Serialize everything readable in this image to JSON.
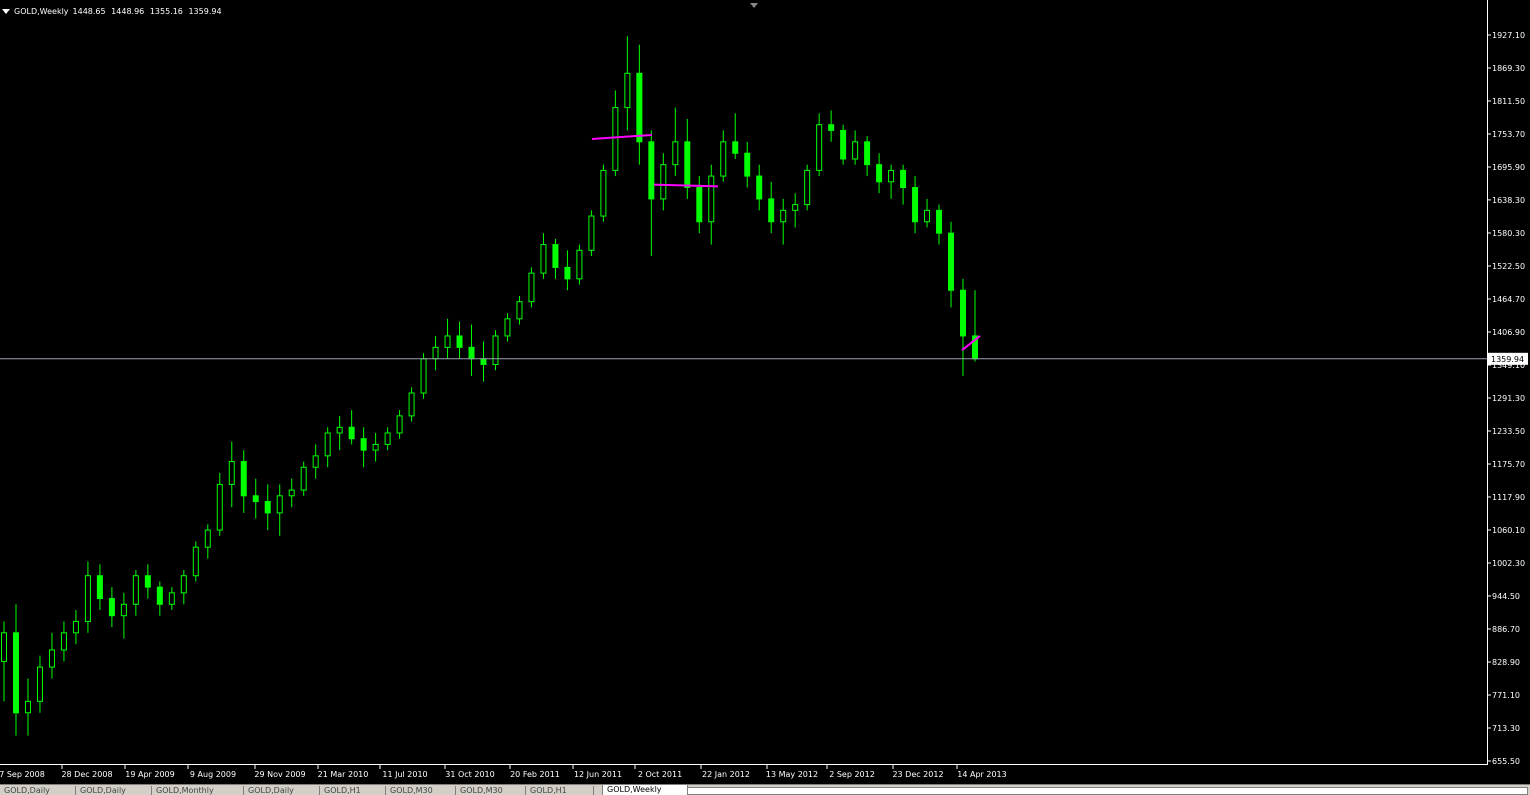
{
  "header": {
    "symbol_timeframe": "GOLD,Weekly",
    "open": "1448.65",
    "high": "1448.96",
    "low": "1355.16",
    "close": "1359.94"
  },
  "price_axis": {
    "labels": [
      "1927.10",
      "1869.30",
      "1811.50",
      "1753.70",
      "1695.90",
      "1638.30",
      "1580.30",
      "1522.50",
      "1464.70",
      "1406.90",
      "1349.10",
      "1291.30",
      "1233.50",
      "1175.70",
      "1117.90",
      "1060.10",
      "1002.30",
      "944.50",
      "886.70",
      "828.90",
      "771.10",
      "713.30",
      "655.50"
    ],
    "current_price": "1359.94"
  },
  "time_axis": {
    "labels": [
      "7 Sep 2008",
      "28 Dec 2008",
      "19 Apr 2009",
      "9 Aug 2009",
      "29 Nov 2009",
      "21 Mar 2010",
      "11 Jul 2010",
      "31 Oct 2010",
      "20 Feb 2011",
      "12 Jun 2011",
      "2 Oct 2011",
      "22 Jan 2012",
      "13 May 2012",
      "2 Sep 2012",
      "23 Dec 2012",
      "14 Apr 2013"
    ]
  },
  "tabs": [
    {
      "label": "GOLD,Daily",
      "active": false
    },
    {
      "label": "GOLD,Daily",
      "active": false
    },
    {
      "label": "GOLD,Monthly",
      "active": false
    },
    {
      "label": "GOLD,Daily",
      "active": false
    },
    {
      "label": "GOLD,H1",
      "active": false
    },
    {
      "label": "GOLD,M30",
      "active": false
    },
    {
      "label": "GOLD,M30",
      "active": false
    },
    {
      "label": "GOLD,H1",
      "active": false
    },
    {
      "label": "GOLD,Weekly",
      "active": true
    }
  ],
  "colors": {
    "background": "#000000",
    "candle": "#00ff00",
    "annotation": "#ff00ff",
    "price_line": "#9aa0b0"
  },
  "chart_data": {
    "type": "candlestick",
    "x": [
      "7 Sep 2008",
      "28 Dec 2008",
      "19 Apr 2009",
      "9 Aug 2009",
      "29 Nov 2009",
      "21 Mar 2010",
      "11 Jul 2010",
      "31 Oct 2010",
      "20 Feb 2011",
      "12 Jun 2011",
      "2 Oct 2011",
      "22 Jan 2012",
      "13 May 2012",
      "2 Sep 2012",
      "23 Dec 2012",
      "14 Apr 2013"
    ],
    "series": [
      {
        "values": [
          [
            830,
            900,
            760,
            880
          ],
          [
            880,
            930,
            700,
            740
          ],
          [
            740,
            800,
            700,
            760
          ],
          [
            760,
            840,
            740,
            820
          ],
          [
            820,
            880,
            800,
            850
          ],
          [
            850,
            900,
            830,
            880
          ],
          [
            880,
            920,
            860,
            900
          ],
          [
            900,
            1005,
            880,
            980
          ],
          [
            980,
            1000,
            920,
            940
          ],
          [
            940,
            960,
            890,
            910
          ],
          [
            910,
            950,
            870,
            930
          ],
          [
            930,
            990,
            910,
            980
          ],
          [
            980,
            1000,
            940,
            960
          ],
          [
            960,
            970,
            910,
            930
          ],
          [
            930,
            960,
            920,
            950
          ],
          [
            950,
            990,
            930,
            980
          ],
          [
            980,
            1040,
            970,
            1030
          ],
          [
            1030,
            1070,
            1010,
            1060
          ],
          [
            1060,
            1160,
            1050,
            1140
          ],
          [
            1140,
            1215,
            1100,
            1180
          ],
          [
            1180,
            1200,
            1090,
            1120
          ],
          [
            1120,
            1150,
            1080,
            1110
          ],
          [
            1110,
            1140,
            1060,
            1090
          ],
          [
            1090,
            1140,
            1050,
            1120
          ],
          [
            1120,
            1150,
            1100,
            1130
          ],
          [
            1130,
            1180,
            1120,
            1170
          ],
          [
            1170,
            1210,
            1150,
            1190
          ],
          [
            1190,
            1240,
            1170,
            1230
          ],
          [
            1230,
            1260,
            1200,
            1240
          ],
          [
            1240,
            1270,
            1210,
            1220
          ],
          [
            1220,
            1240,
            1170,
            1200
          ],
          [
            1200,
            1230,
            1180,
            1210
          ],
          [
            1210,
            1240,
            1200,
            1230
          ],
          [
            1230,
            1270,
            1220,
            1260
          ],
          [
            1260,
            1310,
            1250,
            1300
          ],
          [
            1300,
            1370,
            1290,
            1360
          ],
          [
            1360,
            1400,
            1340,
            1380
          ],
          [
            1380,
            1430,
            1360,
            1400
          ],
          [
            1400,
            1425,
            1360,
            1380
          ],
          [
            1380,
            1420,
            1330,
            1360
          ],
          [
            1360,
            1390,
            1320,
            1350
          ],
          [
            1350,
            1410,
            1340,
            1400
          ],
          [
            1400,
            1440,
            1390,
            1430
          ],
          [
            1430,
            1470,
            1420,
            1460
          ],
          [
            1460,
            1520,
            1450,
            1510
          ],
          [
            1510,
            1580,
            1500,
            1560
          ],
          [
            1560,
            1570,
            1500,
            1520
          ],
          [
            1520,
            1550,
            1480,
            1500
          ],
          [
            1500,
            1560,
            1490,
            1550
          ],
          [
            1550,
            1620,
            1540,
            1610
          ],
          [
            1610,
            1700,
            1600,
            1690
          ],
          [
            1690,
            1830,
            1680,
            1800
          ],
          [
            1800,
            1925,
            1760,
            1860
          ],
          [
            1860,
            1910,
            1700,
            1740
          ],
          [
            1740,
            1760,
            1540,
            1640
          ],
          [
            1640,
            1720,
            1620,
            1700
          ],
          [
            1700,
            1800,
            1680,
            1740
          ],
          [
            1740,
            1780,
            1640,
            1660
          ],
          [
            1660,
            1680,
            1580,
            1600
          ],
          [
            1600,
            1700,
            1560,
            1680
          ],
          [
            1680,
            1760,
            1670,
            1740
          ],
          [
            1740,
            1790,
            1710,
            1720
          ],
          [
            1720,
            1740,
            1660,
            1680
          ],
          [
            1680,
            1700,
            1620,
            1640
          ],
          [
            1640,
            1670,
            1580,
            1600
          ],
          [
            1600,
            1640,
            1560,
            1620
          ],
          [
            1620,
            1650,
            1590,
            1630
          ],
          [
            1630,
            1700,
            1620,
            1690
          ],
          [
            1690,
            1790,
            1680,
            1770
          ],
          [
            1770,
            1795,
            1740,
            1760
          ],
          [
            1760,
            1770,
            1700,
            1710
          ],
          [
            1710,
            1760,
            1700,
            1740
          ],
          [
            1740,
            1750,
            1680,
            1700
          ],
          [
            1700,
            1720,
            1650,
            1670
          ],
          [
            1670,
            1700,
            1640,
            1690
          ],
          [
            1690,
            1700,
            1630,
            1660
          ],
          [
            1660,
            1680,
            1580,
            1600
          ],
          [
            1600,
            1640,
            1590,
            1620
          ],
          [
            1620,
            1630,
            1560,
            1580
          ],
          [
            1580,
            1600,
            1450,
            1480
          ],
          [
            1480,
            1500,
            1330,
            1400
          ],
          [
            1400,
            1480,
            1355,
            1360
          ]
        ]
      }
    ],
    "y_range": [
      655.5,
      1927.1
    ],
    "current_price": 1359.94,
    "annotations": [
      {
        "type": "trendline",
        "from": [
          "12 Jun 2011",
          1745
        ],
        "to": [
          "2 Oct 2011",
          1752
        ]
      },
      {
        "type": "trendline",
        "from": [
          "2 Oct 2011",
          1665
        ],
        "to": [
          "22 Jan 2012",
          1662
        ]
      },
      {
        "type": "trendline",
        "from": [
          "14 Apr 2013",
          1375
        ],
        "to": [
          "14 Apr 2013",
          1400
        ]
      }
    ]
  }
}
